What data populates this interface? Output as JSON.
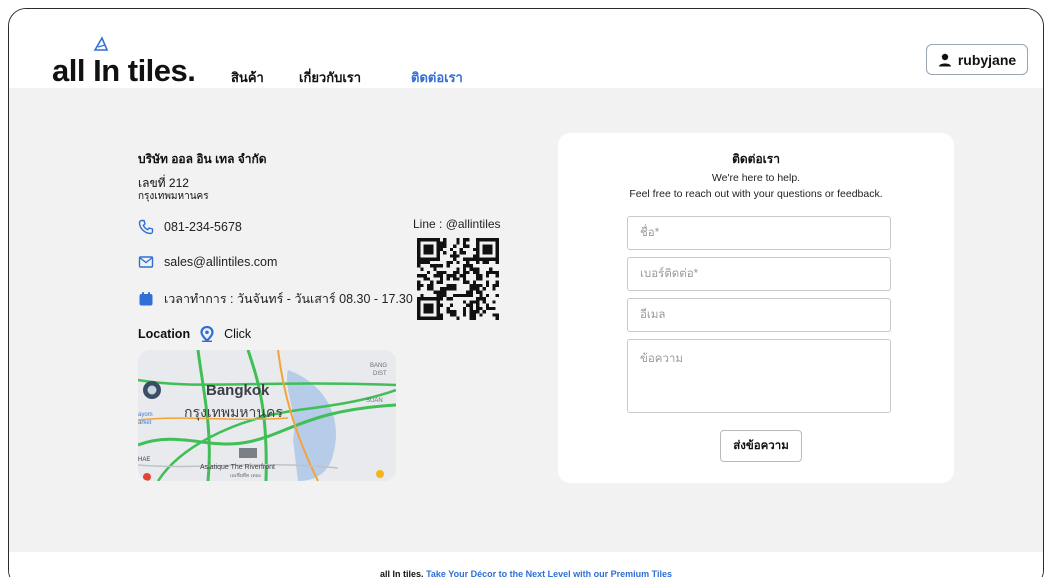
{
  "header": {
    "logo_text": "all In tiles.",
    "nav": [
      {
        "label": "สินค้า"
      },
      {
        "label": "เกี่ยวกับเรา"
      },
      {
        "label": "ติดต่อเรา",
        "active": true
      }
    ],
    "user": {
      "name": "rubyjane",
      "icon": "user-icon"
    }
  },
  "contact": {
    "company": "บริษัท ออล อิน เทล จำกัด",
    "address_line1": "เลขที่ 212",
    "address_line2": "กรุงเทพมหานคร",
    "phone": "081-234-5678",
    "email": "sales@allintiles.com",
    "hours": "เวลาทำการ :  วันจันทร์ - วันเสาร์  08.30 - 17.30",
    "line": "Line : @allintiles",
    "location_label": "Location",
    "location_link": "Click",
    "accent_color": "#2f6fd6"
  },
  "map": {
    "labels": [
      "Bangkok",
      "กรุงเทพมหานคร",
      "Asiatique The Riverfront",
      "เอเชียทีค เดอะ",
      "BANG",
      "DIST",
      "SUAN",
      "ayom",
      "arket",
      "HAE"
    ]
  },
  "form": {
    "title": "ติดต่อเรา",
    "subtitle1": "We're here to help.",
    "subtitle2": "Feel free to reach out with your questions or feedback.",
    "name_placeholder": "ชื่อ*",
    "phone_placeholder": "เบอร์ติดต่อ*",
    "email_placeholder": "อีเมล",
    "message_placeholder": "ข้อความ",
    "submit_label": "ส่งข้อความ"
  },
  "footer": {
    "brand": "all In tiles.",
    "tagline": "Take Your Décor to the Next Level with our Premium Tiles"
  }
}
